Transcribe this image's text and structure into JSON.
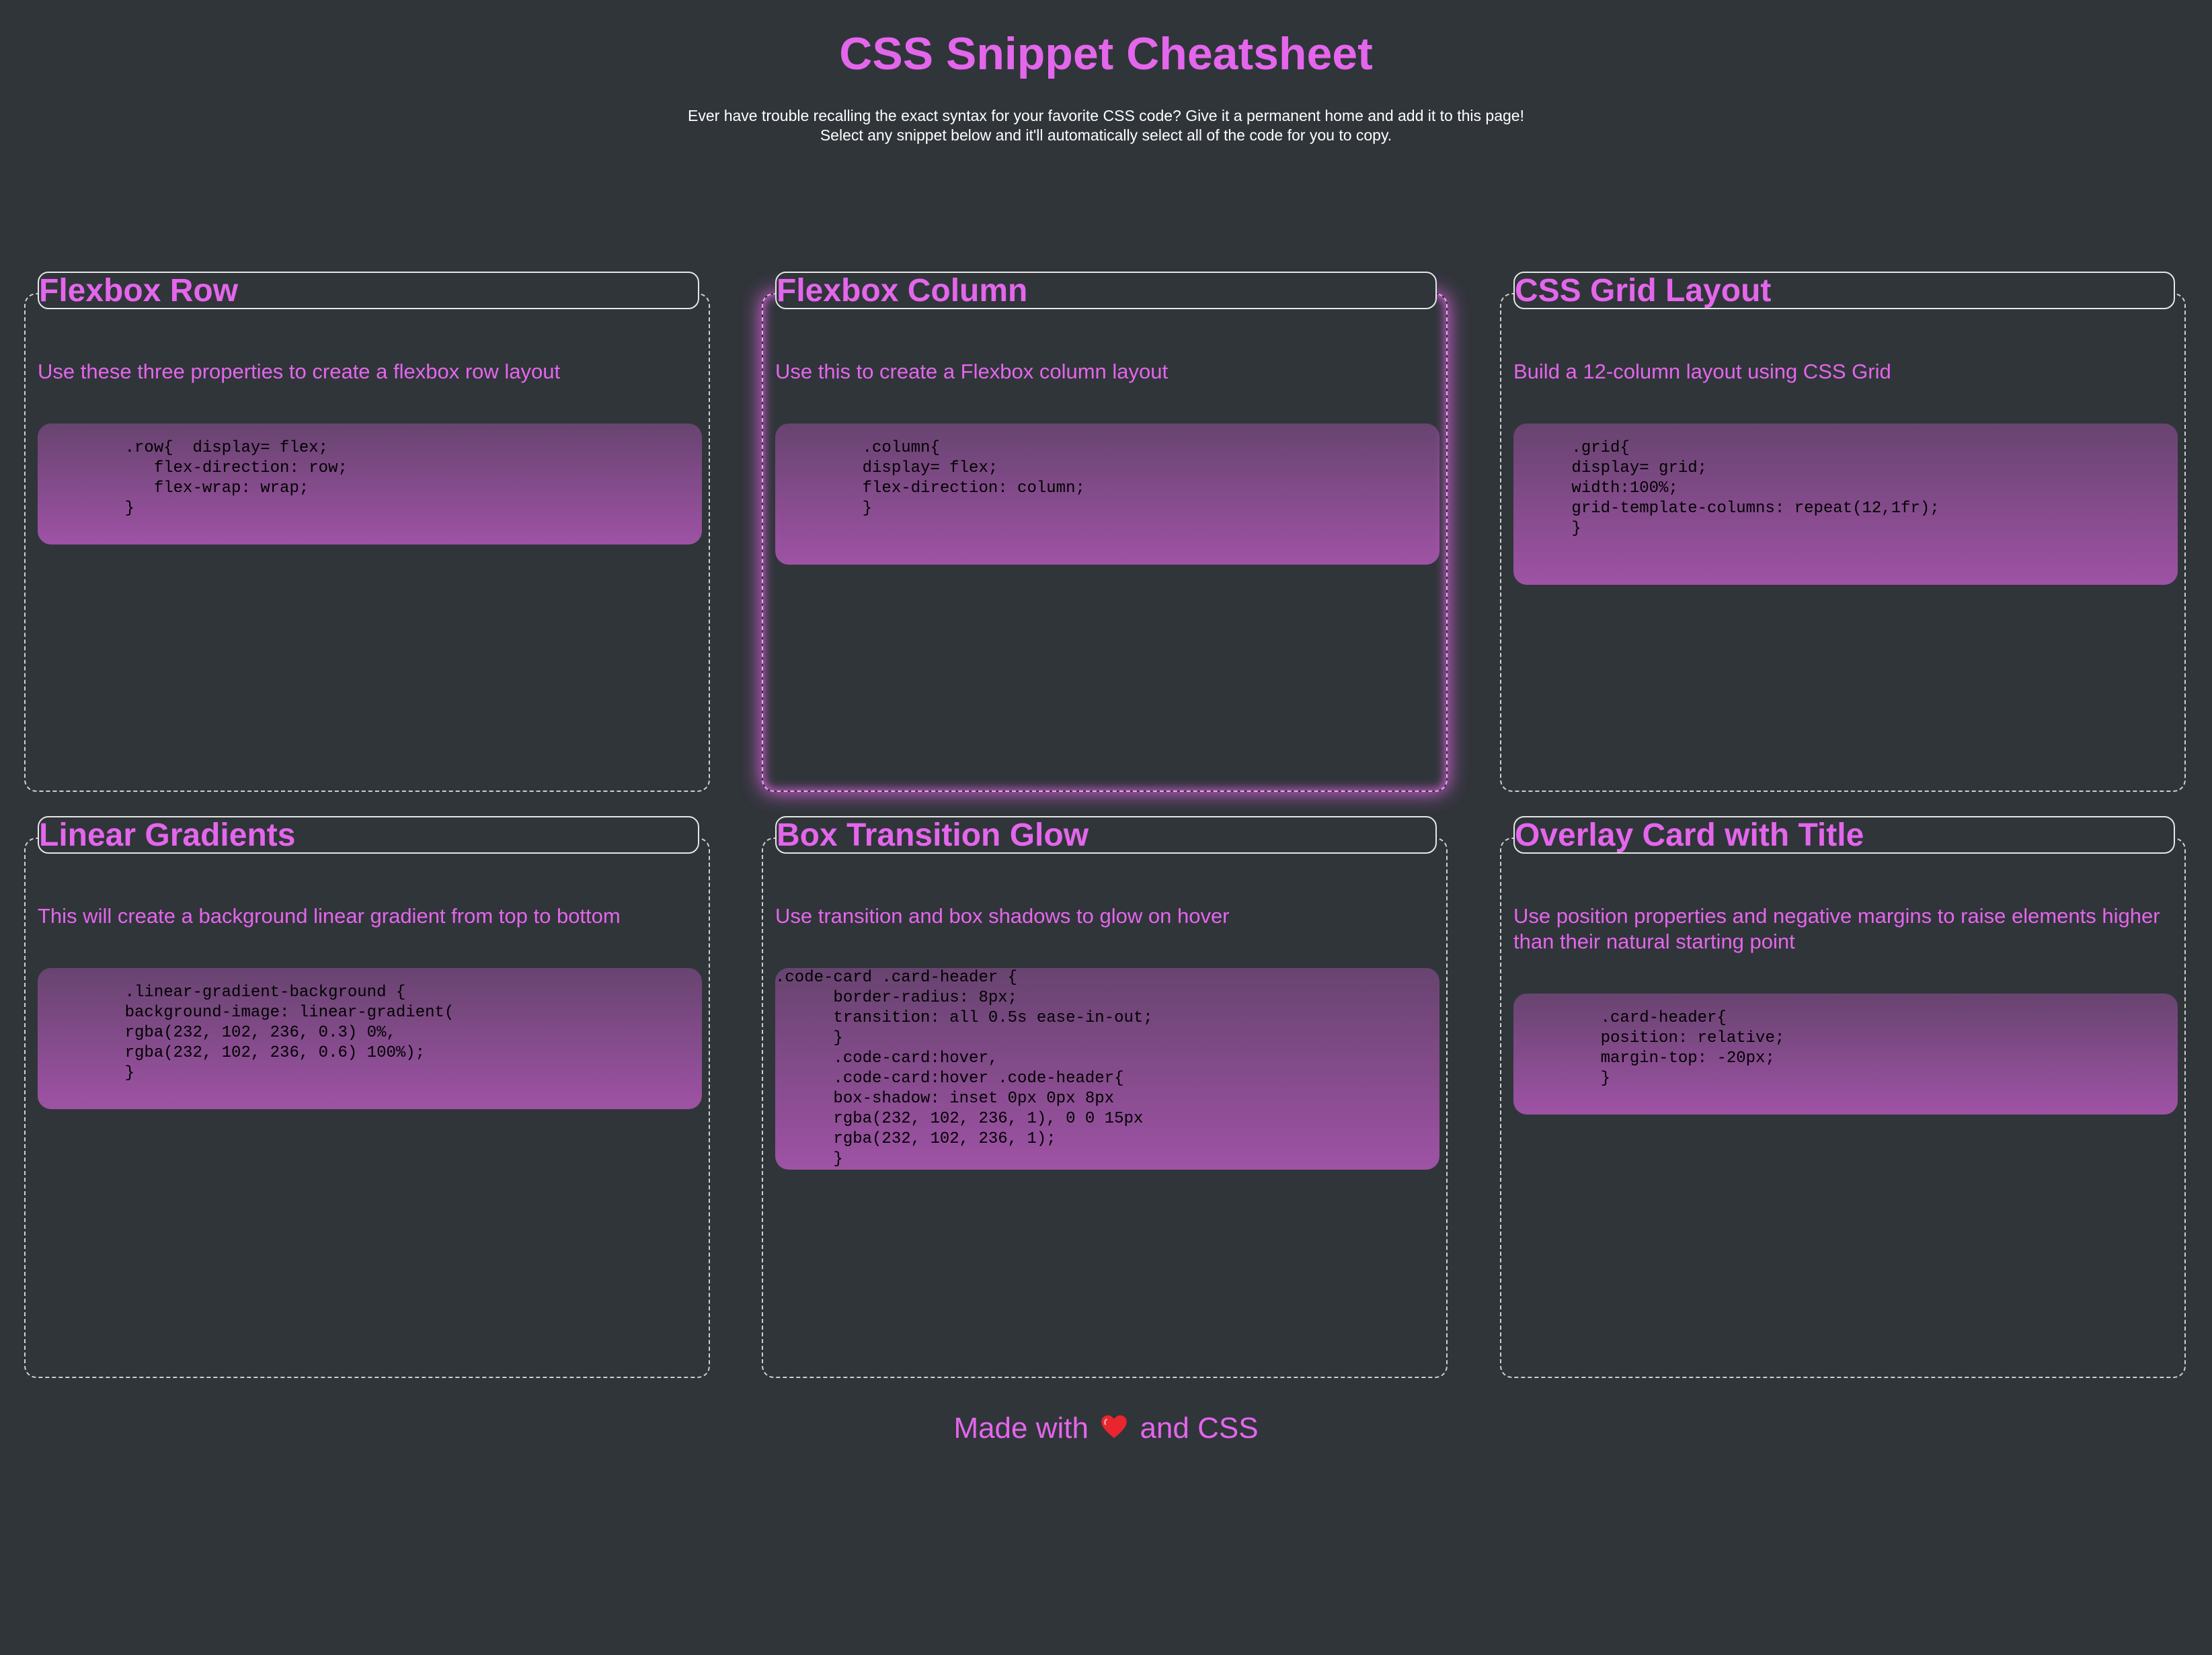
{
  "header": {
    "title": "CSS Snippet Cheatsheet",
    "intro_line1": "Ever have trouble recalling the exact syntax for your favorite CSS code? Give it a permanent home and add it to this page!",
    "intro_line2": "Select any snippet below and it'll automatically select all of the code for you to copy."
  },
  "cards": [
    {
      "title": "Flexbox Row",
      "description": "Use these three properties to create a flexbox row layout",
      "code": "         .row{  display= flex;\n            flex-direction: row;\n            flex-wrap: wrap;\n         }"
    },
    {
      "title": "Flexbox Column",
      "description": "Use this to create a Flexbox column layout",
      "code": "         .column{\n         display= flex;\n         flex-direction: column;\n         }"
    },
    {
      "title": "CSS Grid Layout",
      "description": "Build a 12-column layout using CSS Grid",
      "code": "      .grid{\n      display= grid;\n      width:100%;\n      grid-template-columns: repeat(12,1fr);\n      }"
    },
    {
      "title": "Linear Gradients",
      "description": "This will create a background linear gradient from top to bottom",
      "code": "         .linear-gradient-background {\n         background-image: linear-gradient(\n         rgba(232, 102, 236, 0.3) 0%,\n         rgba(232, 102, 236, 0.6) 100%);\n         }"
    },
    {
      "title": "Box Transition Glow",
      "description": "Use transition and box shadows to glow on hover",
      "code": ".code-card .card-header {\n      border-radius: 8px;\n      transition: all 0.5s ease-in-out;\n      }\n      .code-card:hover,\n      .code-card:hover .code-header{\n      box-shadow: inset 0px 0px 8px\n      rgba(232, 102, 236, 1), 0 0 15px\n      rgba(232, 102, 236, 1);\n      }"
    },
    {
      "title": "Overlay Card with Title",
      "description": "Use position properties and negative margins to raise elements higher than their natural starting point",
      "code": "         .card-header{\n         position: relative;\n         margin-top: -20px;\n         }"
    }
  ],
  "footer": {
    "text_before": "Made with",
    "icon": "heart-icon",
    "text_after": "and CSS"
  },
  "colors": {
    "background": "#30353a",
    "accent": "#e466ec",
    "heart": "#e8262e"
  }
}
